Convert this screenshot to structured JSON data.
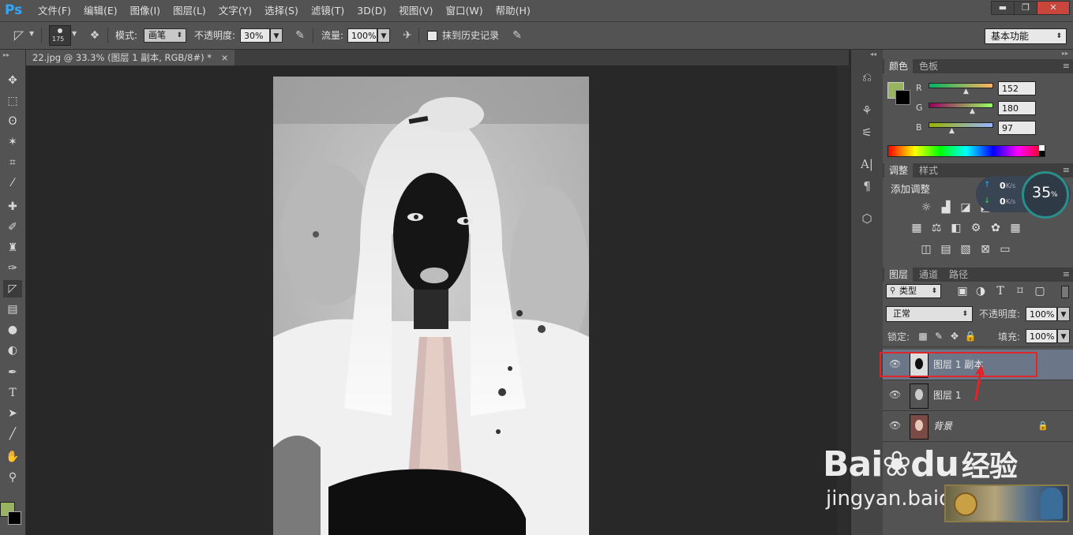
{
  "app": {
    "logo": "Ps"
  },
  "menu": [
    "文件(F)",
    "编辑(E)",
    "图像(I)",
    "图层(L)",
    "文字(Y)",
    "选择(S)",
    "滤镜(T)",
    "3D(D)",
    "视图(V)",
    "窗口(W)",
    "帮助(H)"
  ],
  "window_controls": {
    "minimize": "▬",
    "restore": "❐",
    "close": "✕"
  },
  "options": {
    "brush_size": "175",
    "mode_label": "模式:",
    "mode_value": "画笔",
    "opacity_label": "不透明度:",
    "opacity_value": "30%",
    "flow_label": "流量:",
    "flow_value": "100%",
    "history_label": "抹到历史记录",
    "workspace": "基本功能"
  },
  "document": {
    "tab_label": "22.jpg @ 33.3% (图层 1 副本, RGB/8#) *",
    "close": "×"
  },
  "color_panel": {
    "tabs": [
      "颜色",
      "色板"
    ],
    "r_label": "R",
    "r_value": "152",
    "g_label": "G",
    "g_value": "180",
    "b_label": "B",
    "b_value": "97",
    "foreground": "#98b461",
    "background": "#000000"
  },
  "adjust_panel": {
    "tabs": [
      "调整",
      "样式"
    ],
    "title": "添加调整"
  },
  "net_widget": {
    "up": "0",
    "down": "0",
    "unit": "K/s",
    "percent": "35",
    "percent_sign": "%"
  },
  "layers_panel": {
    "tabs": [
      "图层",
      "通道",
      "路径"
    ],
    "filter_label": "类型",
    "blend_mode": "正常",
    "opacity_label": "不透明度:",
    "opacity_value": "100%",
    "lock_label": "锁定:",
    "fill_label": "填充:",
    "fill_value": "100%",
    "layers": [
      {
        "name": "图层 1 副本"
      },
      {
        "name": "图层 1"
      },
      {
        "name": "背景"
      }
    ]
  },
  "watermark": {
    "brand": "Bai",
    "brand2": "du",
    "cn": "经验",
    "url": "jingyan.baidu.com"
  }
}
